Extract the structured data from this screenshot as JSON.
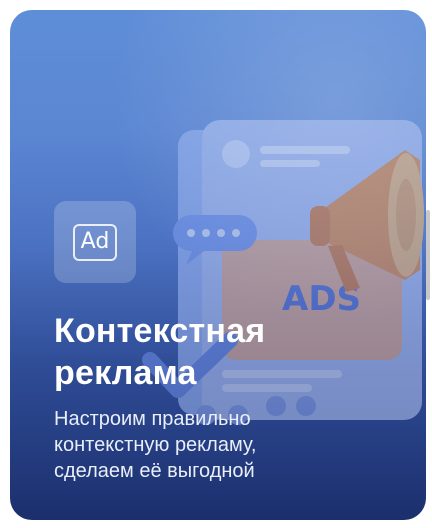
{
  "card": {
    "badge_label": "Ad",
    "title_line1": "Контекстная",
    "title_line2": "реклама",
    "description_line1": "Настроим правильно",
    "description_line2": "контекстную рекламу,",
    "description_line3": "сделаем её выгодной",
    "illustration_text": "ADS"
  },
  "icons": {
    "badge": "ad-icon",
    "megaphone": "megaphone-icon",
    "chat": "chat-bubble-icon",
    "check": "checkmark-icon"
  },
  "colors": {
    "card_top": "#5f8ed8",
    "card_bottom": "#1b2f6d",
    "megaphone": "#f2913a",
    "text": "#ffffff"
  }
}
